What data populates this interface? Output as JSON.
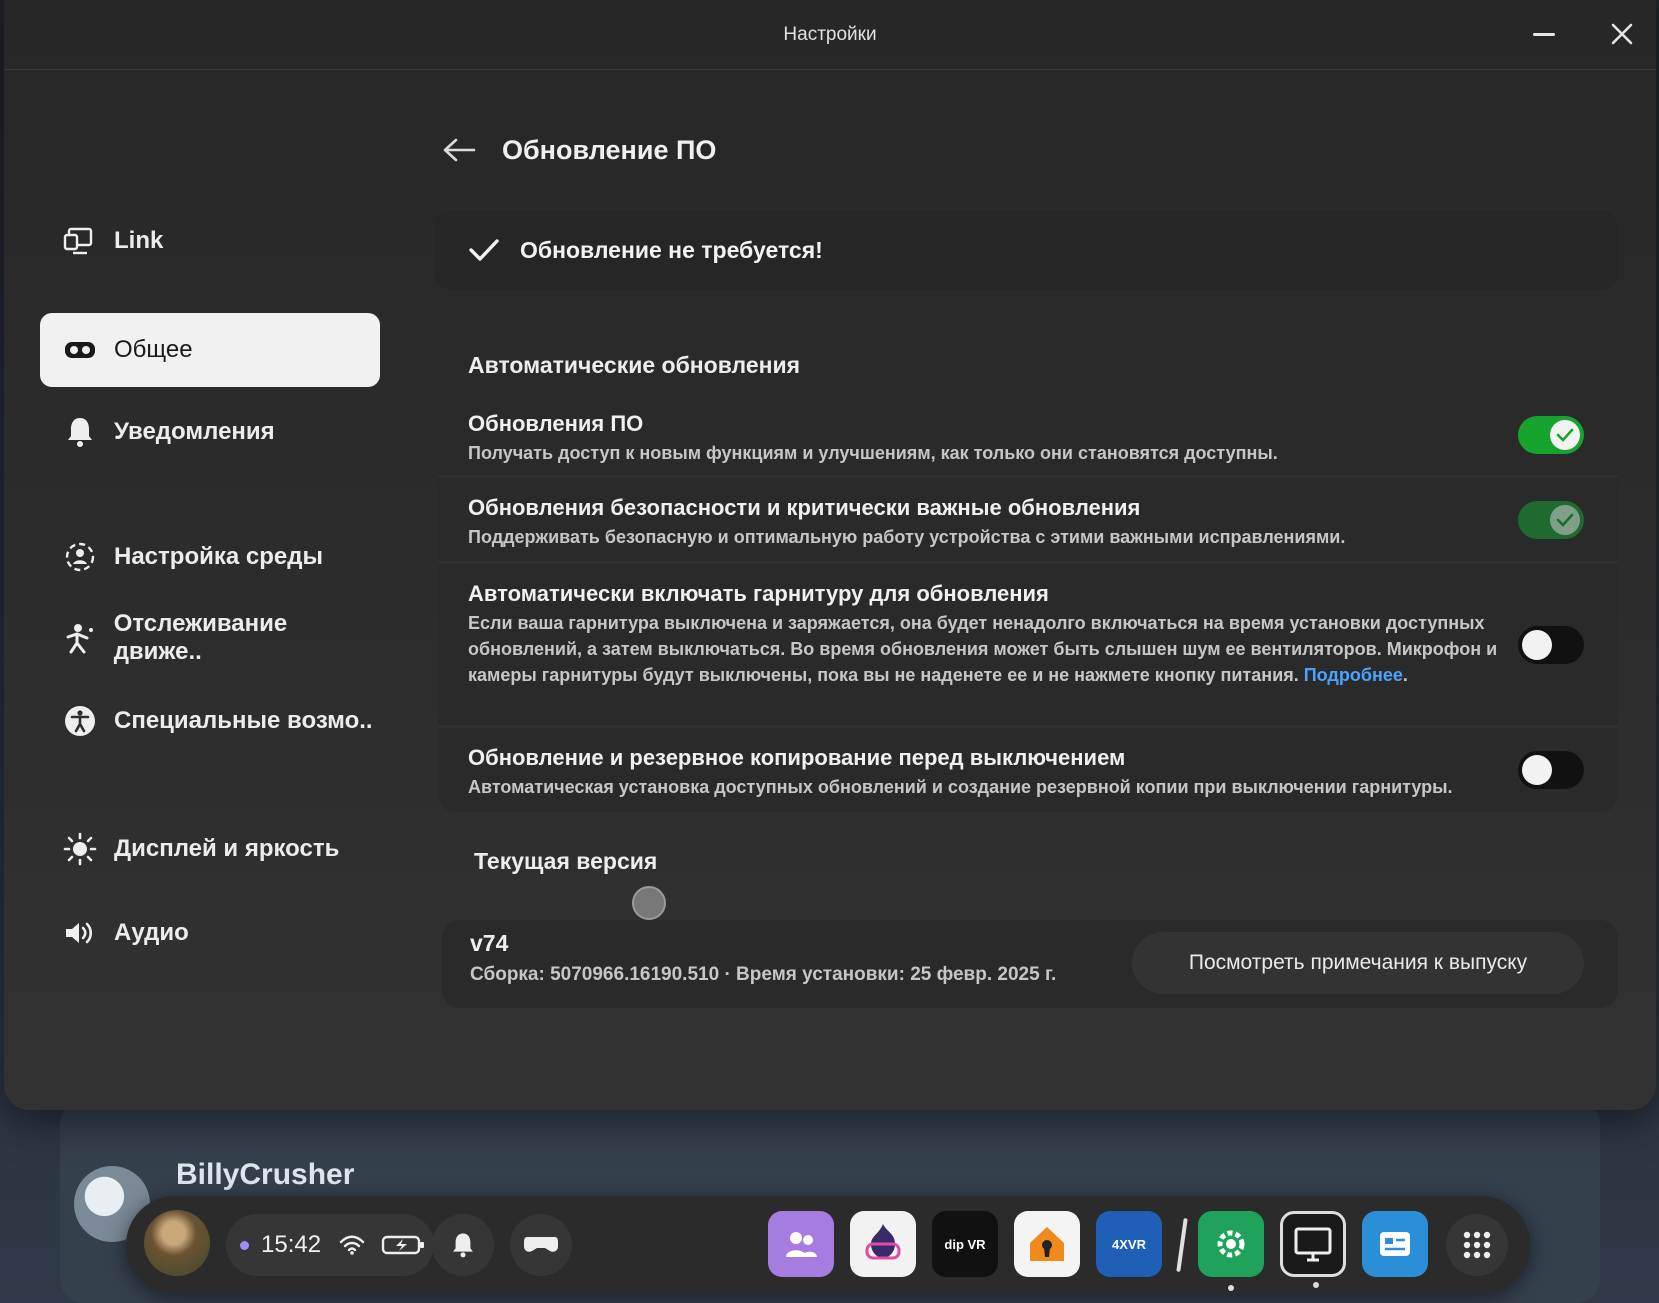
{
  "window": {
    "title": "Настройки"
  },
  "sidebar": {
    "items": [
      {
        "label": "Link",
        "icon": "link-icon",
        "active": false
      },
      {
        "label": "Общее",
        "icon": "headset-icon",
        "active": true
      },
      {
        "label": "Уведомления",
        "icon": "bell-icon",
        "active": false
      },
      {
        "label": "Настройка среды",
        "icon": "environment-icon",
        "active": false
      },
      {
        "label": "Отслеживание движе..",
        "icon": "movement-icon",
        "active": false
      },
      {
        "label": "Специальные возмо..",
        "icon": "accessibility-icon",
        "active": false
      },
      {
        "label": "Дисплей и яркость",
        "icon": "brightness-icon",
        "active": false
      },
      {
        "label": "Аудио",
        "icon": "speaker-icon",
        "active": false
      }
    ]
  },
  "main": {
    "page_title": "Обновление ПО",
    "status": "Обновление не требуется!",
    "auto_section_title": "Автоматические обновления",
    "settings": [
      {
        "title": "Обновления ПО",
        "description": "Получать доступ к новым функциям и улучшениям, как только они становятся доступны.",
        "enabled": true
      },
      {
        "title": "Обновления безопасности и критически важные обновления",
        "description": "Поддерживать безопасную и оптимальную работу устройства с этими важными исправлениями.",
        "enabled": true
      },
      {
        "title": "Автоматически включать гарнитуру для обновления",
        "description": "Если ваша гарнитура выключена и заряжается, она будет ненадолго включаться на время установки доступных обновлений, а затем выключаться. Во время обновления может быть слышен шум ее вентиляторов. Микрофон и камеры гарнитуры будут выключены, пока вы не наденете ее и не нажмете кнопку питания.",
        "link": "Подробнее",
        "enabled": false
      },
      {
        "title": "Обновление и резервное копирование перед выключением",
        "description": "Автоматическая установка доступных обновлений и создание резервной копии при выключении гарнитуры.",
        "enabled": false
      }
    ],
    "version_section_title": "Текущая версия",
    "version": "v74",
    "build_info": "Сборка: 5070966.16190.510 · Время установки: 25 февр. 2025 г.",
    "release_notes_button": "Посмотреть примечания к выпуску"
  },
  "background": {
    "username": "BillyCrusher"
  },
  "taskbar": {
    "time": "15:42",
    "apps": [
      {
        "name": "people-app",
        "label": ""
      },
      {
        "name": "gaming-app",
        "label": ""
      },
      {
        "name": "dipvr-app",
        "label": "dip VR"
      },
      {
        "name": "lock-app",
        "label": ""
      },
      {
        "name": "4xvr-app",
        "label": "4XVR"
      },
      {
        "name": "settings-app",
        "label": ""
      },
      {
        "name": "monitor-app",
        "label": ""
      },
      {
        "name": "browser-app",
        "label": ""
      },
      {
        "name": "all-apps",
        "label": ""
      }
    ]
  },
  "colors": {
    "accent_link": "#4aa3ff",
    "toggle_on": "#16a32e"
  }
}
